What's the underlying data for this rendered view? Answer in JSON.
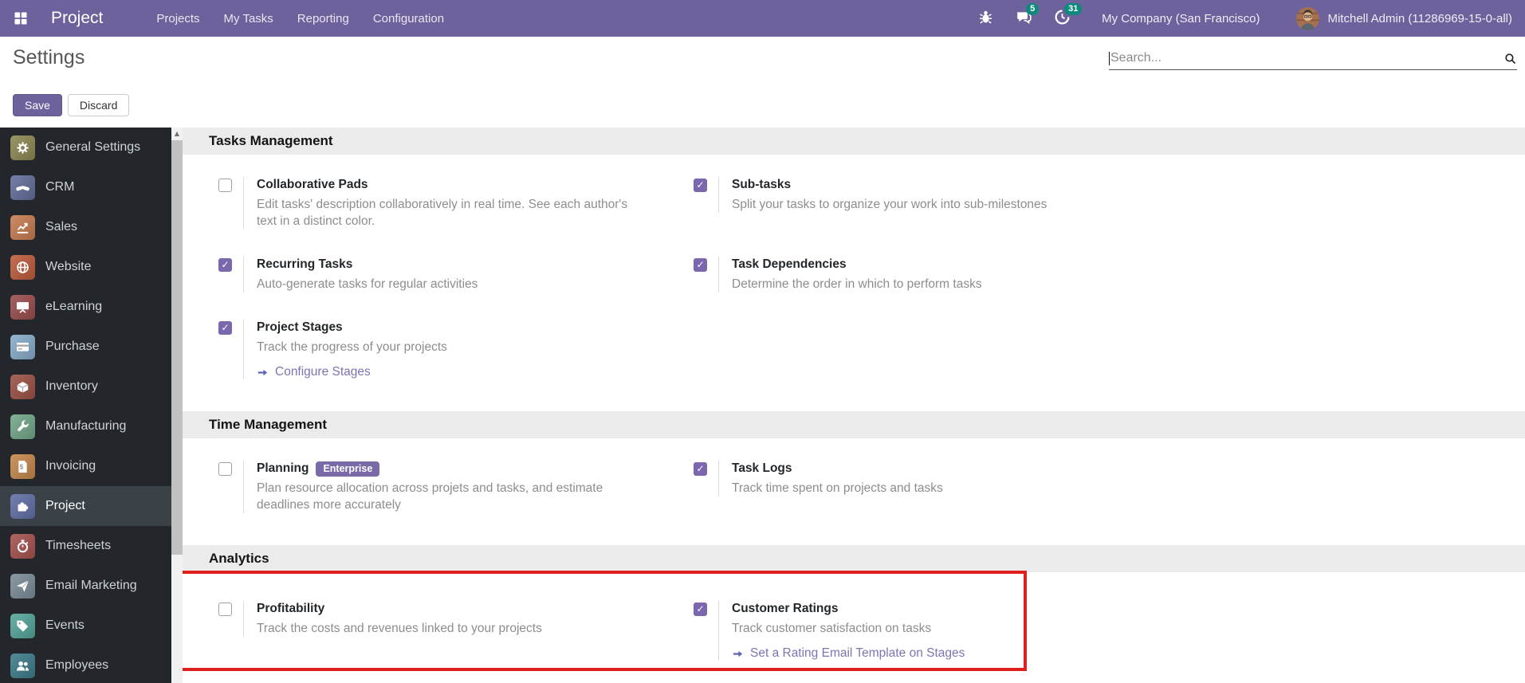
{
  "topbar": {
    "brand": "Project",
    "menus": [
      "Projects",
      "My Tasks",
      "Reporting",
      "Configuration"
    ],
    "icon_buttons": [
      {
        "icon": "bug-icon",
        "badge": null
      },
      {
        "icon": "messages-icon",
        "badge": "5"
      },
      {
        "icon": "activities-clock-icon",
        "badge": "31"
      }
    ],
    "company": "My Company (San Francisco)",
    "user": "Mitchell Admin (11286969-15-0-all)"
  },
  "control": {
    "title": "Settings",
    "save_label": "Save",
    "discard_label": "Discard",
    "search_placeholder": "Search..."
  },
  "sidebar": {
    "items": [
      {
        "label": "General Settings",
        "icon": "gear-icon",
        "color": "#8f8a55",
        "selected": false
      },
      {
        "label": "CRM",
        "icon": "handshake-icon",
        "color": "#65719c",
        "selected": false
      },
      {
        "label": "Sales",
        "icon": "sales-chart-icon",
        "color": "#c87e52",
        "selected": false
      },
      {
        "label": "Website",
        "icon": "globe-icon",
        "color": "#bf5e3e",
        "selected": false
      },
      {
        "label": "eLearning",
        "icon": "presentation-icon",
        "color": "#9c4f4f",
        "selected": false
      },
      {
        "label": "Purchase",
        "icon": "purchase-card-icon",
        "color": "#89aecb",
        "selected": false
      },
      {
        "label": "Inventory",
        "icon": "inventory-box-icon",
        "color": "#9e5347",
        "selected": false
      },
      {
        "label": "Manufacturing",
        "icon": "wrench-icon",
        "color": "#74a98b",
        "selected": false
      },
      {
        "label": "Invoicing",
        "icon": "invoice-icon",
        "color": "#c78a4e",
        "selected": false
      },
      {
        "label": "Project",
        "icon": "puzzle-icon",
        "color": "#6471a8",
        "selected": true
      },
      {
        "label": "Timesheets",
        "icon": "stopwatch-icon",
        "color": "#a85450",
        "selected": false
      },
      {
        "label": "Email Marketing",
        "icon": "paper-plane-icon",
        "color": "#7d8f99",
        "selected": false
      },
      {
        "label": "Events",
        "icon": "tags-icon",
        "color": "#56a79c",
        "selected": false
      },
      {
        "label": "Employees",
        "icon": "employees-icon",
        "color": "#3f7e8c",
        "selected": false
      }
    ]
  },
  "sections": [
    {
      "title": "Tasks Management",
      "highlighted": false,
      "rows": [
        [
          {
            "title": "Collaborative Pads",
            "checked": false,
            "badge": null,
            "desc": "Edit tasks' description collaboratively in real time. See each author's text in a distinct color.",
            "link": null
          },
          {
            "title": "Sub-tasks",
            "checked": true,
            "badge": null,
            "desc": "Split your tasks to organize your work into sub-milestones",
            "link": null
          }
        ],
        [
          {
            "title": "Recurring Tasks",
            "checked": true,
            "badge": null,
            "desc": "Auto-generate tasks for regular activities",
            "link": null
          },
          {
            "title": "Task Dependencies",
            "checked": true,
            "badge": null,
            "desc": "Determine the order in which to perform tasks",
            "link": null
          }
        ],
        [
          {
            "title": "Project Stages",
            "checked": true,
            "badge": null,
            "desc": "Track the progress of your projects",
            "link": "Configure Stages"
          },
          null
        ]
      ]
    },
    {
      "title": "Time Management",
      "highlighted": false,
      "rows": [
        [
          {
            "title": "Planning",
            "checked": false,
            "badge": "Enterprise",
            "desc": "Plan resource allocation across projets and tasks, and estimate deadlines more accurately",
            "link": null
          },
          {
            "title": "Task Logs",
            "checked": true,
            "badge": null,
            "desc": "Track time spent on projects and tasks",
            "link": null
          }
        ]
      ]
    },
    {
      "title": "Analytics",
      "highlighted": true,
      "rows": [
        [
          {
            "title": "Profitability",
            "checked": false,
            "badge": null,
            "desc": "Track the costs and revenues linked to your projects",
            "link": null
          },
          {
            "title": "Customer Ratings",
            "checked": true,
            "badge": null,
            "desc": "Track customer satisfaction on tasks",
            "link": "Set a Rating Email Template on Stages"
          }
        ]
      ]
    }
  ],
  "colors": {
    "topbar": "#6e629d",
    "badge": "#0e8a7d",
    "checkbox": "#7a67ad",
    "highlight": "#e0201d",
    "link": "#7d74b2"
  }
}
